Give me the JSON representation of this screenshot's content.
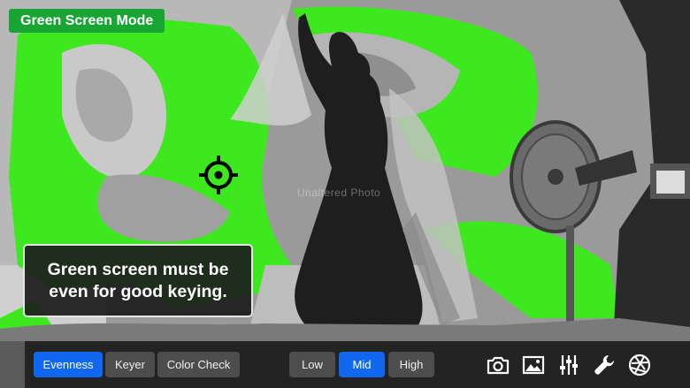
{
  "mode": {
    "title": "Green Screen Mode"
  },
  "overlay": {
    "message": "Green screen must be even for good keying.",
    "watermark": "Unaltered Photo"
  },
  "toolbar": {
    "views": [
      {
        "label": "Evenness",
        "active": true
      },
      {
        "label": "Keyer",
        "active": false
      },
      {
        "label": "Color Check",
        "active": false
      }
    ],
    "levels": [
      {
        "label": "Low",
        "active": false
      },
      {
        "label": "Mid",
        "active": true
      },
      {
        "label": "High",
        "active": false
      }
    ],
    "tools": [
      "camera-icon",
      "image-icon",
      "sliders-icon",
      "wrench-icon",
      "aperture-icon"
    ]
  },
  "colors": {
    "accent": "#1168f0",
    "mode_badge": "#18a534",
    "key_green": "#3de81f"
  }
}
